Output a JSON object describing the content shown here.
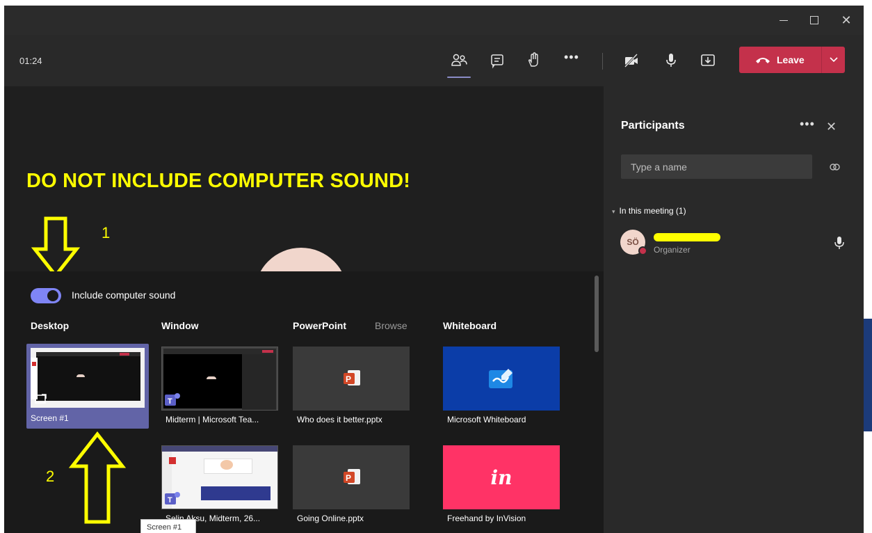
{
  "window": {
    "minimize": "–",
    "maximize": "□",
    "close": "✕"
  },
  "toolbar": {
    "timer": "01:24",
    "icons": [
      "participants-icon",
      "chat-icon",
      "raise-hand-icon",
      "more-icon",
      "camera-off-icon",
      "microphone-icon",
      "share-tray-icon"
    ],
    "more_label": "•••",
    "leave_label": "Leave",
    "leave_color": "#c4314b"
  },
  "annotations": {
    "warning": "DO NOT INCLUDE COMPUTER SOUND!",
    "step1": "1",
    "step2": "2",
    "color": "#ffff00"
  },
  "share": {
    "toggle_label": "Include computer sound",
    "toggle_on": true,
    "accent": "#7f85f5",
    "sections": {
      "desktop": "Desktop",
      "window": "Window",
      "powerpoint": "PowerPoint",
      "browse": "Browse",
      "whiteboard": "Whiteboard"
    },
    "desktop": [
      {
        "label": "Screen #1",
        "selected": true
      }
    ],
    "windows": [
      {
        "label": "Midterm | Microsoft Tea..."
      },
      {
        "label": "Selin Aksu, Midterm, 26..."
      }
    ],
    "powerpoint": [
      {
        "label": "Who does it better.pptx"
      },
      {
        "label": "Going Online.pptx"
      }
    ],
    "whiteboard": [
      {
        "label": "Microsoft Whiteboard"
      },
      {
        "label": "Freehand by InVision",
        "logo": "in"
      }
    ],
    "tooltip": "Screen #1"
  },
  "participants": {
    "title": "Participants",
    "more_label": "•••",
    "close_label": "✕",
    "search_placeholder": "Type a name",
    "section": "In this meeting (1)",
    "people": [
      {
        "initials": "SÖ",
        "role": "Organizer"
      }
    ]
  }
}
